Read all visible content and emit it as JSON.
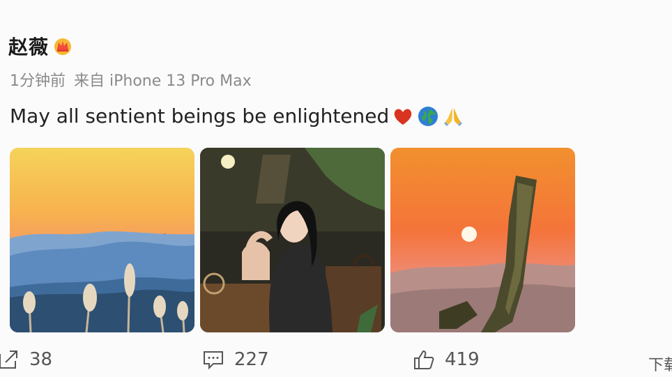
{
  "post": {
    "author": "赵薇",
    "time": "1分钟前",
    "source": "来自 iPhone 13 Pro Max",
    "text": "May all sentient beings be enlightened",
    "emojis": [
      "heart-icon",
      "globe-icon",
      "praying-hands-icon"
    ],
    "images": [
      "sunset-mountains-photo",
      "woman-portrait-photo",
      "sunset-banana-leaf-photo"
    ]
  },
  "actions": {
    "share_count": "38",
    "comment_count": "227",
    "like_count": "419",
    "more_label": "下载"
  }
}
